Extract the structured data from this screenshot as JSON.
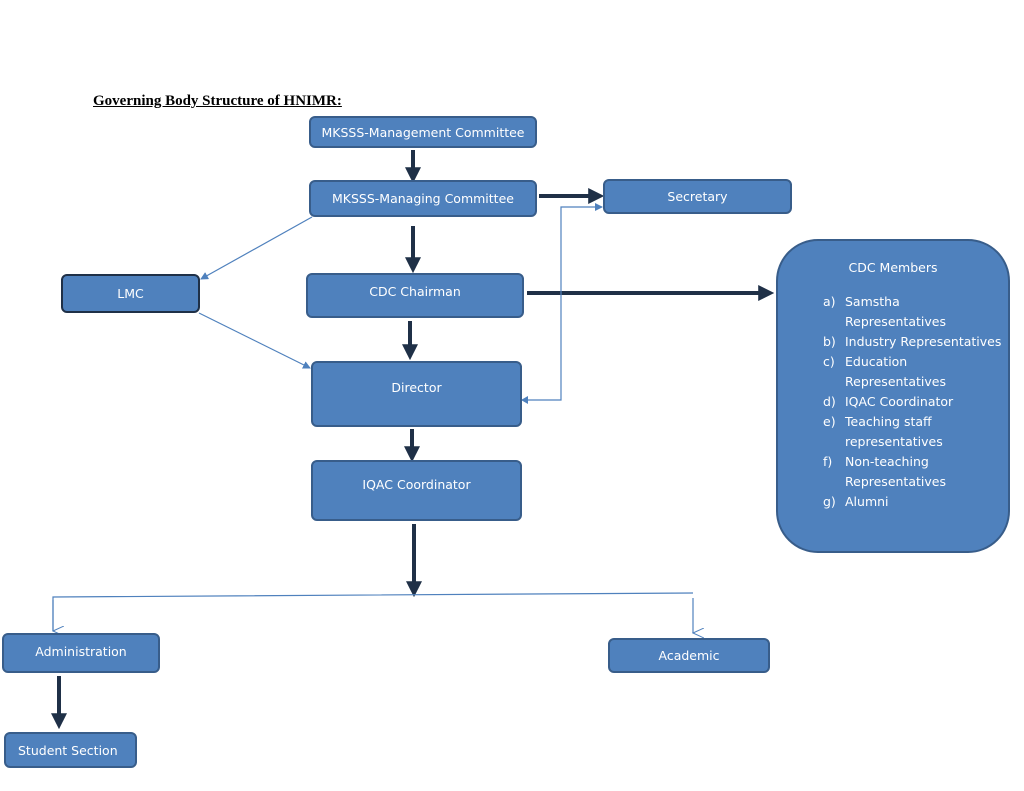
{
  "title": "Governing Body Structure of HNIMR",
  "title_suffix": ":",
  "nodes": {
    "management_committee": "MKSSS-Management Committee",
    "managing_committee": "MKSSS-Managing Committee",
    "secretary": "Secretary",
    "lmc": "LMC",
    "cdc_chairman": "CDC Chairman",
    "director": "Director",
    "iqac_coordinator": "IQAC Coordinator",
    "administration": "Administration",
    "academic": "Academic",
    "student_section": "Student Section"
  },
  "cdc_members": {
    "heading": "CDC Members",
    "items": [
      {
        "marker": "a)",
        "text": "Samstha Representatives"
      },
      {
        "marker": "b)",
        "text": "Industry Representatives"
      },
      {
        "marker": "c)",
        "text": "Education Representatives"
      },
      {
        "marker": "d)",
        "text": "IQAC Coordinator"
      },
      {
        "marker": "e)",
        "text": "Teaching staff representatives"
      },
      {
        "marker": "f)",
        "text": "Non-teaching Representatives"
      },
      {
        "marker": "g)",
        "text": "Alumni"
      }
    ]
  },
  "colors": {
    "box_fill": "#4f81bd",
    "box_border": "#385d8a",
    "thick_arrow": "#1f3047",
    "thin_arrow": "#4f81bd"
  }
}
